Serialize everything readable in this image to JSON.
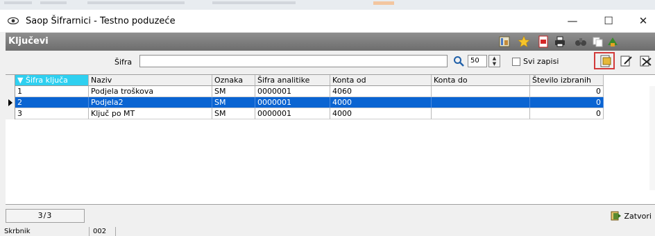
{
  "window": {
    "title": "Saop Šifrarnici - Testno poduzeće",
    "minimize": "—",
    "maximize": "☐",
    "close": "✕"
  },
  "panel": {
    "title": "Ključevi"
  },
  "filter": {
    "label": "Šifra",
    "value": "",
    "count": "50",
    "show_all_label": "Svi zapisi",
    "show_all_checked": false
  },
  "grid": {
    "columns": [
      "Šifra ključa",
      "Naziv",
      "Oznaka",
      "Šifra analitike",
      "Konta od",
      "Konta do",
      "Število izbranih"
    ],
    "rows": [
      {
        "sifra": "1",
        "naziv": "Podjela troškova",
        "oznaka": "SM",
        "analitika": "0000001",
        "konta_od": "4060",
        "konta_do": "",
        "broj": "0",
        "selected": false
      },
      {
        "sifra": "2",
        "naziv": "Podjela2",
        "oznaka": "SM",
        "analitika": "0000001",
        "konta_od": "4000",
        "konta_do": "",
        "broj": "0",
        "selected": true
      },
      {
        "sifra": "3",
        "naziv": "Ključ po MT",
        "oznaka": "SM",
        "analitika": "0000001",
        "konta_od": "4000",
        "konta_do": "",
        "broj": "0",
        "selected": false
      }
    ]
  },
  "footer": {
    "record_counter": "3/3",
    "close_label": "Zatvori"
  },
  "status": {
    "user_label": "Skrbnik",
    "code": "002"
  },
  "colors": {
    "selection": "#0a64d2",
    "sorted_header": "#2fd0f0",
    "panel_bar": "#7a7a7a",
    "highlight_box": "#d23a3a"
  }
}
